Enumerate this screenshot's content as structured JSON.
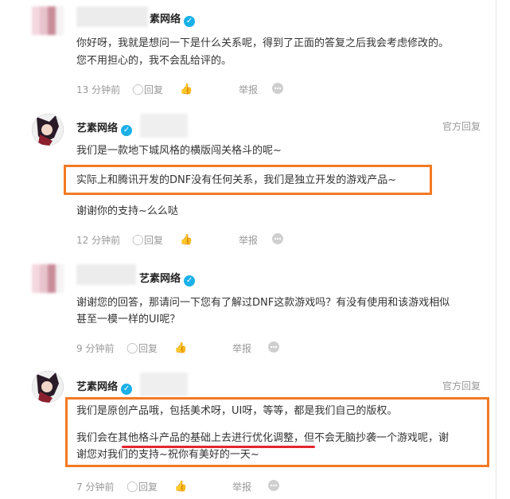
{
  "comments": [
    {
      "author": "素网络",
      "lines": [
        "你好呀，我就是想问一下是什么关系呢，得到了正面的答复之后我会考虑修改的。",
        "您不用担心的，我不会乱给评的。"
      ],
      "time": "13 分钟前",
      "reply_label": "回复",
      "report_label": "举报"
    },
    {
      "author": "艺素网络",
      "badge": "官方回复",
      "lines": [
        "我们是一款地下城风格的横版闯关格斗的呢~",
        "实际上和腾讯开发的DNF没有任何关系，我们是独立开发的游戏产品~",
        "谢谢你的支持~么么哒"
      ],
      "time": "12 分钟前",
      "reply_label": "回复",
      "report_label": "举报"
    },
    {
      "author": "艺素网络",
      "lines": [
        "谢谢您的回答，那请问一下您有了解过DNF这款游戏吗？有没有使用和该游戏相似",
        "甚至一模一样的UI呢？"
      ],
      "time": "9 分钟前",
      "reply_label": "回复",
      "report_label": "举报"
    },
    {
      "author": "艺素网络",
      "badge": "官方回复",
      "lines": [
        "我们是原创产品哦，包括美术呀，UI呀，等等，都是我们自己的版权。",
        "我们会在其他格斗产品的基础上去进行优化调整，但不会无脑抄袭一个游戏呢，谢",
        "谢您对我们的支持~祝你有美好的一天~"
      ],
      "time": "7 分钟前",
      "reply_label": "回复",
      "report_label": "举报"
    }
  ],
  "icons": {
    "verified": "verified-check-icon",
    "reply": "reply-bubble-icon",
    "like": "thumbs-up-icon",
    "more": "more-dots-icon"
  },
  "colors": {
    "highlight_box": "#f37a23",
    "underline": "#e3262d",
    "verified": "#1ab0e8",
    "meta_text": "#999999"
  }
}
